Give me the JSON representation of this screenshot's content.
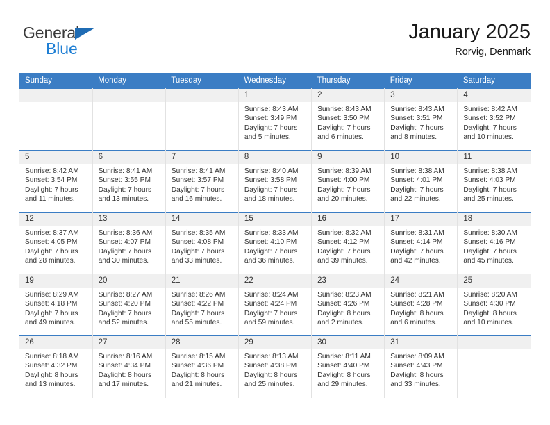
{
  "brand": {
    "name_top": "General",
    "name_bottom": "Blue",
    "triangle_color": "#1f6cb4",
    "blue_color": "#1f7fd4"
  },
  "header": {
    "title": "January 2025",
    "subtitle": "Rorvig, Denmark"
  },
  "theme": {
    "header_blue": "#3b7dc4",
    "daynum_band": "#f0f0f0",
    "grid_line": "#e2e2e2"
  },
  "weekdays": [
    "Sunday",
    "Monday",
    "Tuesday",
    "Wednesday",
    "Thursday",
    "Friday",
    "Saturday"
  ],
  "weeks": [
    [
      {
        "day": "",
        "empty": true
      },
      {
        "day": "",
        "empty": true
      },
      {
        "day": "",
        "empty": true
      },
      {
        "day": "1",
        "sunrise": "Sunrise: 8:43 AM",
        "sunset": "Sunset: 3:49 PM",
        "daylight_1": "Daylight: 7 hours",
        "daylight_2": "and 5 minutes."
      },
      {
        "day": "2",
        "sunrise": "Sunrise: 8:43 AM",
        "sunset": "Sunset: 3:50 PM",
        "daylight_1": "Daylight: 7 hours",
        "daylight_2": "and 6 minutes."
      },
      {
        "day": "3",
        "sunrise": "Sunrise: 8:43 AM",
        "sunset": "Sunset: 3:51 PM",
        "daylight_1": "Daylight: 7 hours",
        "daylight_2": "and 8 minutes."
      },
      {
        "day": "4",
        "sunrise": "Sunrise: 8:42 AM",
        "sunset": "Sunset: 3:52 PM",
        "daylight_1": "Daylight: 7 hours",
        "daylight_2": "and 10 minutes."
      }
    ],
    [
      {
        "day": "5",
        "sunrise": "Sunrise: 8:42 AM",
        "sunset": "Sunset: 3:54 PM",
        "daylight_1": "Daylight: 7 hours",
        "daylight_2": "and 11 minutes."
      },
      {
        "day": "6",
        "sunrise": "Sunrise: 8:41 AM",
        "sunset": "Sunset: 3:55 PM",
        "daylight_1": "Daylight: 7 hours",
        "daylight_2": "and 13 minutes."
      },
      {
        "day": "7",
        "sunrise": "Sunrise: 8:41 AM",
        "sunset": "Sunset: 3:57 PM",
        "daylight_1": "Daylight: 7 hours",
        "daylight_2": "and 16 minutes."
      },
      {
        "day": "8",
        "sunrise": "Sunrise: 8:40 AM",
        "sunset": "Sunset: 3:58 PM",
        "daylight_1": "Daylight: 7 hours",
        "daylight_2": "and 18 minutes."
      },
      {
        "day": "9",
        "sunrise": "Sunrise: 8:39 AM",
        "sunset": "Sunset: 4:00 PM",
        "daylight_1": "Daylight: 7 hours",
        "daylight_2": "and 20 minutes."
      },
      {
        "day": "10",
        "sunrise": "Sunrise: 8:38 AM",
        "sunset": "Sunset: 4:01 PM",
        "daylight_1": "Daylight: 7 hours",
        "daylight_2": "and 22 minutes."
      },
      {
        "day": "11",
        "sunrise": "Sunrise: 8:38 AM",
        "sunset": "Sunset: 4:03 PM",
        "daylight_1": "Daylight: 7 hours",
        "daylight_2": "and 25 minutes."
      }
    ],
    [
      {
        "day": "12",
        "sunrise": "Sunrise: 8:37 AM",
        "sunset": "Sunset: 4:05 PM",
        "daylight_1": "Daylight: 7 hours",
        "daylight_2": "and 28 minutes."
      },
      {
        "day": "13",
        "sunrise": "Sunrise: 8:36 AM",
        "sunset": "Sunset: 4:07 PM",
        "daylight_1": "Daylight: 7 hours",
        "daylight_2": "and 30 minutes."
      },
      {
        "day": "14",
        "sunrise": "Sunrise: 8:35 AM",
        "sunset": "Sunset: 4:08 PM",
        "daylight_1": "Daylight: 7 hours",
        "daylight_2": "and 33 minutes."
      },
      {
        "day": "15",
        "sunrise": "Sunrise: 8:33 AM",
        "sunset": "Sunset: 4:10 PM",
        "daylight_1": "Daylight: 7 hours",
        "daylight_2": "and 36 minutes."
      },
      {
        "day": "16",
        "sunrise": "Sunrise: 8:32 AM",
        "sunset": "Sunset: 4:12 PM",
        "daylight_1": "Daylight: 7 hours",
        "daylight_2": "and 39 minutes."
      },
      {
        "day": "17",
        "sunrise": "Sunrise: 8:31 AM",
        "sunset": "Sunset: 4:14 PM",
        "daylight_1": "Daylight: 7 hours",
        "daylight_2": "and 42 minutes."
      },
      {
        "day": "18",
        "sunrise": "Sunrise: 8:30 AM",
        "sunset": "Sunset: 4:16 PM",
        "daylight_1": "Daylight: 7 hours",
        "daylight_2": "and 45 minutes."
      }
    ],
    [
      {
        "day": "19",
        "sunrise": "Sunrise: 8:29 AM",
        "sunset": "Sunset: 4:18 PM",
        "daylight_1": "Daylight: 7 hours",
        "daylight_2": "and 49 minutes."
      },
      {
        "day": "20",
        "sunrise": "Sunrise: 8:27 AM",
        "sunset": "Sunset: 4:20 PM",
        "daylight_1": "Daylight: 7 hours",
        "daylight_2": "and 52 minutes."
      },
      {
        "day": "21",
        "sunrise": "Sunrise: 8:26 AM",
        "sunset": "Sunset: 4:22 PM",
        "daylight_1": "Daylight: 7 hours",
        "daylight_2": "and 55 minutes."
      },
      {
        "day": "22",
        "sunrise": "Sunrise: 8:24 AM",
        "sunset": "Sunset: 4:24 PM",
        "daylight_1": "Daylight: 7 hours",
        "daylight_2": "and 59 minutes."
      },
      {
        "day": "23",
        "sunrise": "Sunrise: 8:23 AM",
        "sunset": "Sunset: 4:26 PM",
        "daylight_1": "Daylight: 8 hours",
        "daylight_2": "and 2 minutes."
      },
      {
        "day": "24",
        "sunrise": "Sunrise: 8:21 AM",
        "sunset": "Sunset: 4:28 PM",
        "daylight_1": "Daylight: 8 hours",
        "daylight_2": "and 6 minutes."
      },
      {
        "day": "25",
        "sunrise": "Sunrise: 8:20 AM",
        "sunset": "Sunset: 4:30 PM",
        "daylight_1": "Daylight: 8 hours",
        "daylight_2": "and 10 minutes."
      }
    ],
    [
      {
        "day": "26",
        "sunrise": "Sunrise: 8:18 AM",
        "sunset": "Sunset: 4:32 PM",
        "daylight_1": "Daylight: 8 hours",
        "daylight_2": "and 13 minutes."
      },
      {
        "day": "27",
        "sunrise": "Sunrise: 8:16 AM",
        "sunset": "Sunset: 4:34 PM",
        "daylight_1": "Daylight: 8 hours",
        "daylight_2": "and 17 minutes."
      },
      {
        "day": "28",
        "sunrise": "Sunrise: 8:15 AM",
        "sunset": "Sunset: 4:36 PM",
        "daylight_1": "Daylight: 8 hours",
        "daylight_2": "and 21 minutes."
      },
      {
        "day": "29",
        "sunrise": "Sunrise: 8:13 AM",
        "sunset": "Sunset: 4:38 PM",
        "daylight_1": "Daylight: 8 hours",
        "daylight_2": "and 25 minutes."
      },
      {
        "day": "30",
        "sunrise": "Sunrise: 8:11 AM",
        "sunset": "Sunset: 4:40 PM",
        "daylight_1": "Daylight: 8 hours",
        "daylight_2": "and 29 minutes."
      },
      {
        "day": "31",
        "sunrise": "Sunrise: 8:09 AM",
        "sunset": "Sunset: 4:43 PM",
        "daylight_1": "Daylight: 8 hours",
        "daylight_2": "and 33 minutes."
      },
      {
        "day": "",
        "empty": true
      }
    ]
  ]
}
